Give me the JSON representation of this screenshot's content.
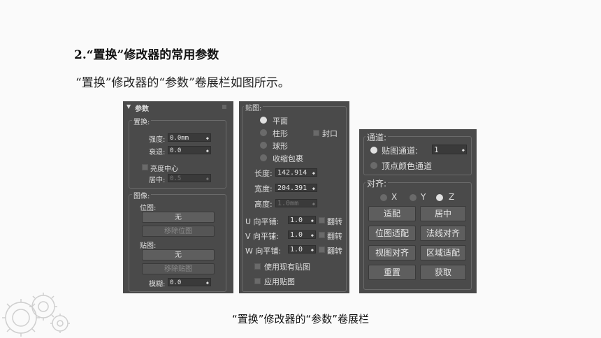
{
  "heading": "2.“置换”修改器的常用参数",
  "description": "“置换”修改器的“参数”卷展栏如图所示。",
  "caption": "“置换”修改器的“参数”卷展栏",
  "panel_left": {
    "rollout_title": "参数",
    "displacement": {
      "group_title": "置换:",
      "strength_label": "强度:",
      "strength_value": "0.0mm",
      "decay_label": "衰退:",
      "decay_value": "0.0",
      "luminance_center_label": "亮度中心",
      "center_label": "居中:",
      "center_value": "0.5"
    },
    "image": {
      "group_title": "图像:",
      "bitmap_label": "位图:",
      "bitmap_button": "无",
      "remove_bitmap_button": "移除位图",
      "map_label": "贴图:",
      "map_button": "无",
      "remove_map_button": "移除贴图",
      "blur_label": "模糊:",
      "blur_value": "0.0"
    }
  },
  "panel_middle": {
    "group_title": "贴图:",
    "planar": "平面",
    "cylindrical": "柱形",
    "cap": "封口",
    "spherical": "球形",
    "shrink_wrap": "收缩包裹",
    "length_label": "长度:",
    "length_value": "142.914",
    "width_label": "宽度:",
    "width_value": "204.391",
    "height_label": "高度:",
    "height_value": "1.0mm",
    "u_tile_label": "U 向平铺:",
    "u_tile_value": "1.0",
    "v_tile_label": "V 向平铺:",
    "v_tile_value": "1.0",
    "w_tile_label": "W 向平铺:",
    "w_tile_value": "1.0",
    "flip_label": "翻转",
    "use_existing_map": "使用现有贴图",
    "apply_map": "应用贴图"
  },
  "panel_right": {
    "channel": {
      "group_title": "通道:",
      "map_channel_label": "贴图通道:",
      "map_channel_value": "1",
      "vertex_color_channel_label": "顶点颜色通道"
    },
    "alignment": {
      "group_title": "对齐:",
      "x_label": "X",
      "y_label": "Y",
      "z_label": "Z",
      "fit_button": "适配",
      "center_button": "居中",
      "bitmap_fit_button": "位图适配",
      "normal_align_button": "法线对齐",
      "view_align_button": "视图对齐",
      "region_fit_button": "区域适配",
      "reset_button": "重置",
      "acquire_button": "获取"
    }
  },
  "colors": {
    "panel_bg": "#4a4a4a",
    "field_bg": "#3a3a3a",
    "button_bg": "#5e5e5e"
  }
}
